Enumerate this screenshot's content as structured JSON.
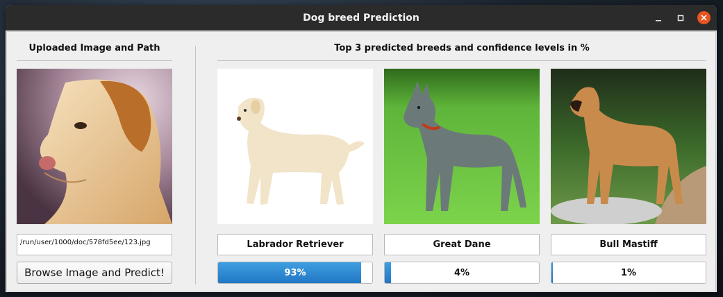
{
  "window": {
    "title": "Dog breed Prediction"
  },
  "left_panel": {
    "heading": "Uploaded Image and Path",
    "image_path": "/run/user/1000/doc/578fd5ee/123.jpg",
    "browse_label": "Browse Image and Predict!"
  },
  "right_panel": {
    "heading": "Top 3 predicted breeds and confidence levels in %",
    "predictions": [
      {
        "breed": "Labrador Retriever",
        "confidence_label": "93%",
        "confidence": 93
      },
      {
        "breed": "Great Dane",
        "confidence_label": "4%",
        "confidence": 4
      },
      {
        "breed": "Bull Mastiff",
        "confidence_label": "1%",
        "confidence": 1
      }
    ]
  },
  "colors": {
    "titlebar": "#2b2b2b",
    "close_button": "#e95420",
    "progress_fill": "#2f8ad6"
  },
  "icons": [
    "minimize-icon",
    "maximize-icon",
    "close-icon"
  ]
}
